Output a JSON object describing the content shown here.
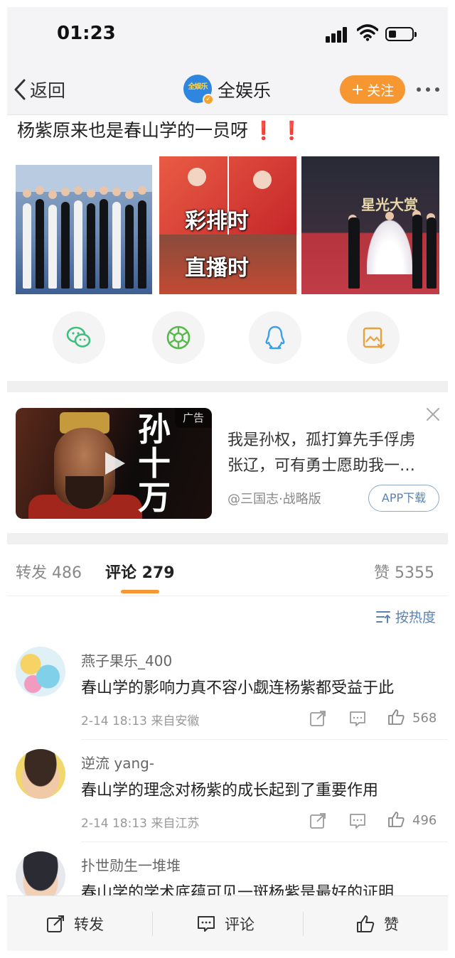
{
  "status_bar": {
    "time": "01:23"
  },
  "nav": {
    "back_label": "返回",
    "account_name": "全娱乐",
    "avatar_text": "全娱乐",
    "follow_label": "关注"
  },
  "post": {
    "text": "杨紫原来也是春山学的一员呀",
    "emoji": "❗ ❗"
  },
  "photos": [
    {
      "caption_top": "",
      "caption_bottom": ""
    },
    {
      "caption_top": "彩排时",
      "caption_bottom": "直播时"
    },
    {
      "caption_top": "",
      "caption_bottom": "星光大赏"
    }
  ],
  "ad": {
    "tag": "广告",
    "image_title": "孙十万",
    "text_line1": "我是孙权，孤打算先手俘虏",
    "text_line2": "张辽，可有勇士愿助我一…",
    "source": "@三国志·战略版",
    "button": "APP下载"
  },
  "tabs": {
    "repost": "转发 486",
    "comment": "评论 279",
    "like": "赞 5355"
  },
  "sort_label": "按热度",
  "comments": [
    {
      "name": "燕子果乐_400",
      "text": "春山学的影响力真不容小觑连杨紫都受益于此",
      "meta": "2-14 18:13  来自安徽",
      "likes": "568"
    },
    {
      "name": "逆流 yang-",
      "text": "春山学的理念对杨紫的成长起到了重要作用",
      "meta": "2-14 18:13  来自江苏",
      "likes": "496"
    },
    {
      "name": "扑世勋生一堆堆",
      "text": "春山学的学术底蕴可见一斑杨紫是最好的证明",
      "meta": "",
      "likes": ""
    }
  ],
  "bottom_bar": {
    "repost": "转发",
    "comment": "评论",
    "like": "赞"
  },
  "colors": {
    "accent_orange": "#f79731",
    "link_blue": "#5b82b0",
    "wechat_green": "#3fbf7f"
  }
}
